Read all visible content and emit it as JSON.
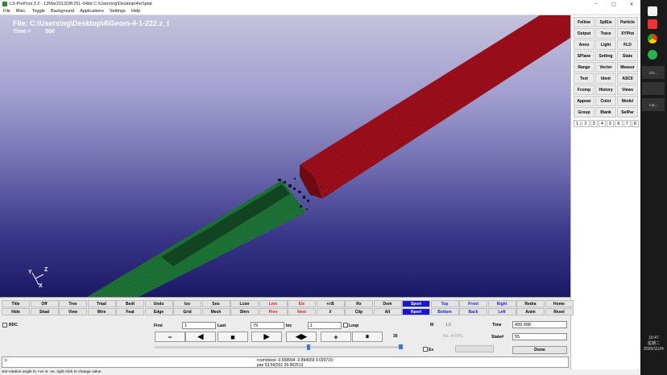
{
  "window": {
    "title": "LS-PrePost 3.2 - 12Mar2012(08:25) -64bit C:\\Users\\ng\\Desktop\\4\\eSplat",
    "minimize": "–",
    "maximize": "▢",
    "close": "✕"
  },
  "menu": [
    "File",
    "Misc.",
    "Toggle",
    "Background",
    "Applications",
    "Settings",
    "Help"
  ],
  "viewport": {
    "file_label": "File: C:\\Users\\ng\\Desktop\\4\\Geom-4-1-222.z_t",
    "time_label": "Time =",
    "time_value": "500",
    "axes": {
      "x": "X",
      "y": "Y",
      "z": "Z"
    },
    "colors": {
      "red_part": "#a3101c",
      "green_part": "#1f7a3a"
    }
  },
  "right_panel": {
    "buttons": [
      "Follow",
      "SplEw",
      "Particle",
      "Output",
      "Trace",
      "XYPlot",
      "Anno",
      "Light",
      "FLD",
      "SPlane",
      "Setting",
      "State",
      "Range",
      "Vector",
      "Measur",
      "Text",
      "Ident",
      "ASCII",
      "Fcomp",
      "History",
      "Views",
      "Appear",
      "Color",
      "Model",
      "Group",
      "Blank",
      "SelPar"
    ],
    "pages": [
      "1",
      "2",
      "3",
      "4",
      "5",
      "6",
      "7",
      "8"
    ]
  },
  "control": {
    "row1": [
      {
        "label": "Title"
      },
      {
        "label": "Off"
      },
      {
        "label": "Tree"
      },
      {
        "label": "Triad"
      },
      {
        "label": "Bedt"
      },
      {
        "label": "Undo"
      },
      {
        "label": "Iso"
      },
      {
        "label": "Sno"
      },
      {
        "label": "Lcon"
      },
      {
        "label": "Lmn",
        "style": "red"
      },
      {
        "label": "Ele",
        "style": "red"
      },
      {
        "label": "+/-B"
      },
      {
        "label": "Rx"
      },
      {
        "label": "Dom"
      },
      {
        "label": "Sport",
        "style": "sel"
      },
      {
        "label": "Top",
        "style": "blue"
      },
      {
        "label": "Front",
        "style": "blue"
      },
      {
        "label": "Right",
        "style": "blue"
      },
      {
        "label": "Redra"
      },
      {
        "label": "Home"
      }
    ],
    "row2": [
      {
        "label": "Hide"
      },
      {
        "label": "Shad"
      },
      {
        "label": "View"
      },
      {
        "label": "Wire"
      },
      {
        "label": "Feat"
      },
      {
        "label": "Edge"
      },
      {
        "label": "Grid"
      },
      {
        "label": "Mesh"
      },
      {
        "label": "Shrn"
      },
      {
        "label": "Prev",
        "style": "red"
      },
      {
        "label": "Next",
        "style": "red"
      },
      {
        "label": "//"
      },
      {
        "label": "Clip"
      },
      {
        "label": "All"
      },
      {
        "label": "Rport",
        "style": "sel"
      },
      {
        "label": "Bottom",
        "style": "blue"
      },
      {
        "label": "Back",
        "style": "blue"
      },
      {
        "label": "Left",
        "style": "blue"
      },
      {
        "label": "Anim"
      },
      {
        "label": "Reset"
      }
    ],
    "rdc_label": "RDC",
    "first_label": "First",
    "first_value": "1",
    "last_label": "Last",
    "last_value": "79",
    "inc_label": "Inc",
    "inc_value": "1",
    "loop_label": "Loop",
    "m_label": "M",
    "m_value": "1.0",
    "time_label": "Time",
    "time_value": "499.998",
    "fps_label": "No. of FPS",
    "state_label": "State#",
    "state_value": "55",
    "speed_value": "30",
    "ev_label": "Ev",
    "done_label": "Done",
    "play_buttons": [
      {
        "symbol": "−",
        "name": "minus-button"
      },
      {
        "symbol": "◀",
        "name": "play-backward-button"
      },
      {
        "symbol": "■",
        "name": "stop-button"
      },
      {
        "symbol": "▶",
        "name": "play-forward-button"
      },
      {
        "symbol": "◀▶",
        "name": "bounce-button"
      },
      {
        "symbol": "+",
        "name": "plus-button"
      },
      {
        "symbol": "⏸",
        "name": "pause-button"
      }
    ],
    "slider_position": 0.62,
    "prompt": ">",
    "output_line1": "rcsmdview -0.558994 -0.894659 0.029719;",
    "output_line2": "pan 53.56(501 39.962513"
  },
  "status": "Set rotation angle to +ve or -ve, right click to change value",
  "taskbar": {
    "app_label1": "Clo...",
    "app_label2": "Cat...",
    "time": "16:47",
    "day": "星期二",
    "date": "2020/11/24"
  }
}
